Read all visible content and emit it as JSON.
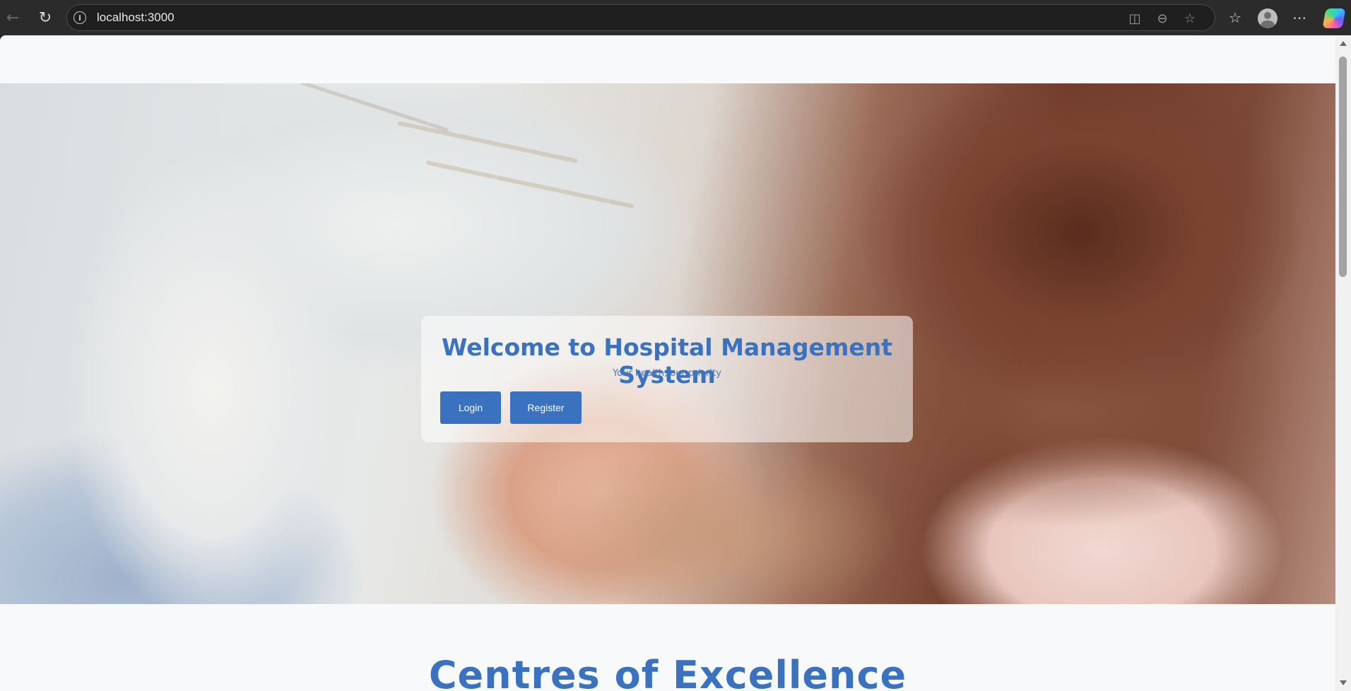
{
  "browser": {
    "url": "localhost:3000",
    "icons": {
      "back": "arrow-left-icon",
      "reload": "reload-icon",
      "site_info": "info-icon",
      "split_screen": "split-screen-icon",
      "zoom": "zoom-out-icon",
      "favorite": "star-icon",
      "favorites": "favorites-list-icon",
      "profile": "profile-avatar-icon",
      "more": "more-icon",
      "copilot": "copilot-icon"
    }
  },
  "hero": {
    "title": "Welcome to Hospital Management System",
    "subtitle": "Your health, our priority",
    "login_label": "Login",
    "register_label": "Register"
  },
  "sections": {
    "excellence_title": "Centres of Excellence"
  },
  "colors": {
    "accent": "#3a72c0",
    "page_bg": "#f8f9fb"
  }
}
